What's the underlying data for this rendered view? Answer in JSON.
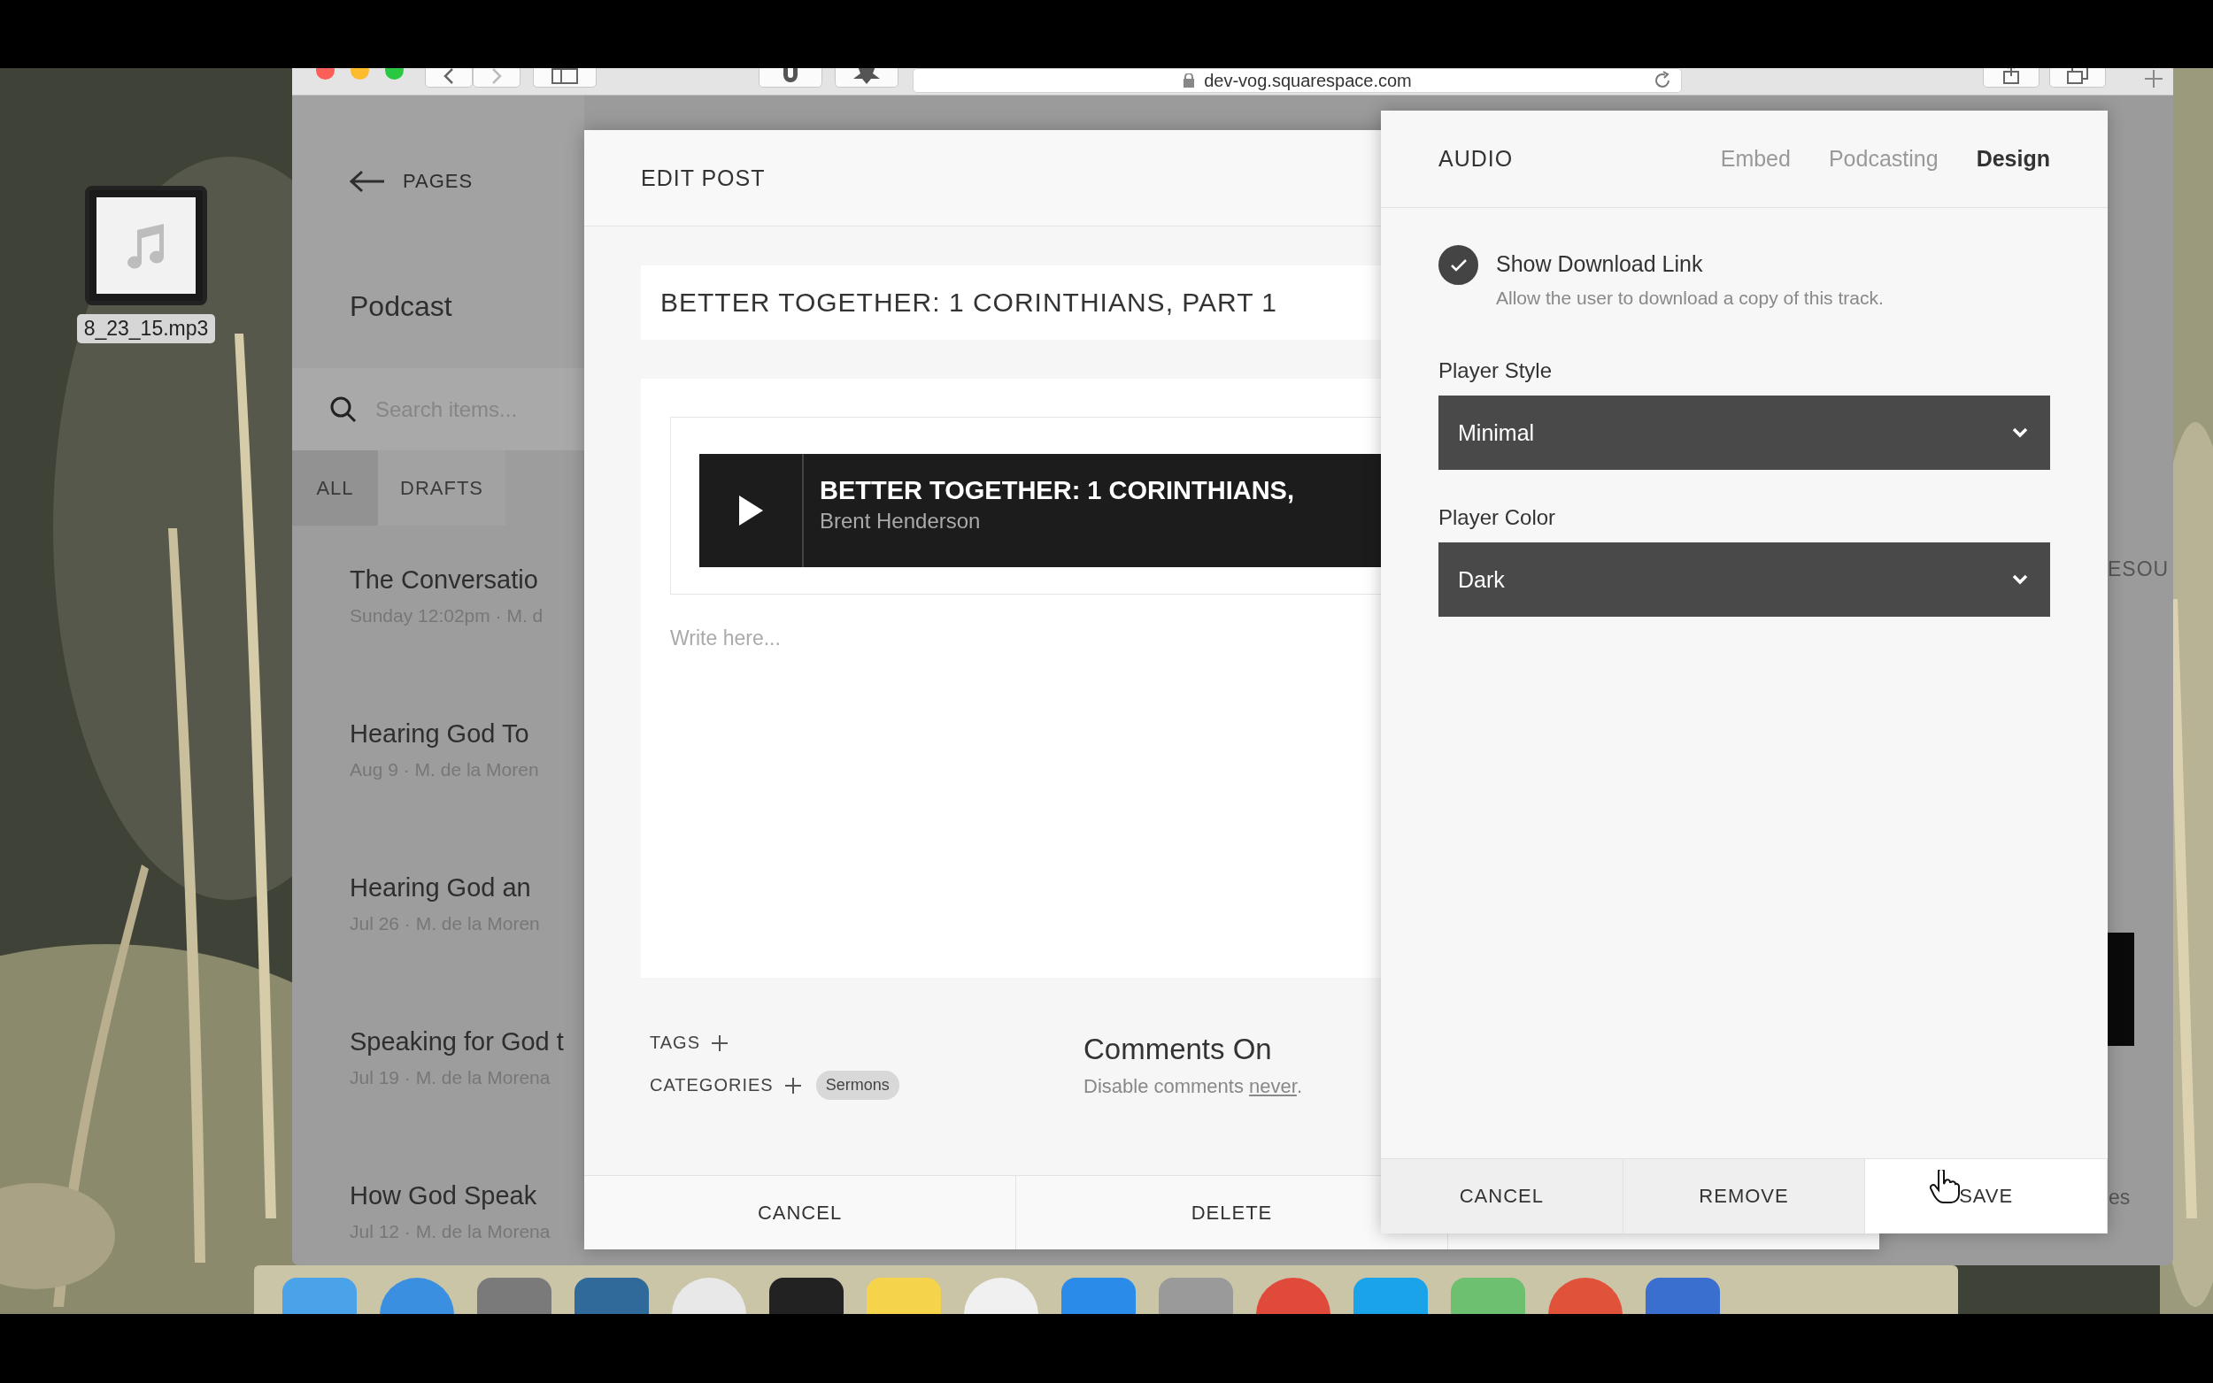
{
  "desktop": {
    "file_icon": {
      "label": "8_23_15.mp3"
    }
  },
  "browser": {
    "address": "dev-vog.squarespace.com"
  },
  "sidebar": {
    "back_label": "PAGES",
    "title": "Podcast",
    "search": {
      "placeholder": "Search items..."
    },
    "tabs": [
      {
        "label": "ALL",
        "selected": true
      },
      {
        "label": "DRAFTS",
        "selected": false
      }
    ],
    "items": [
      {
        "title": "The Conversatio",
        "meta": "Sunday 12:02pm  ·  M. d"
      },
      {
        "title": "Hearing God To",
        "meta": "Aug 9  ·  M. de la Moren"
      },
      {
        "title": "Hearing God an",
        "meta": "Jul 26  ·  M. de la Moren"
      },
      {
        "title": "Speaking for God t",
        "meta": "Jul 19  ·  M. de la Morena"
      },
      {
        "title": "How God Speak",
        "meta": "Jul 12  ·  M. de la Morena"
      }
    ]
  },
  "edit_post": {
    "title": "EDIT POST",
    "post_title": "BETTER TOGETHER: 1 CORINTHIANS, PART 1",
    "audio_block": {
      "title": "BETTER TOGETHER: 1 CORINTHIANS,",
      "artist": "Brent Henderson"
    },
    "body": {
      "placeholder": "Write here..."
    },
    "tags_label": "TAGS",
    "categories_label": "CATEGORIES",
    "categories": [
      "Sermons"
    ],
    "comments": {
      "title": "Comments On",
      "text": "Disable comments",
      "link": "never",
      "end": "."
    },
    "buttons": [
      "CANCEL",
      "DELETE"
    ]
  },
  "background_page": {
    "heading_fragment": "ESOU",
    "text_fragment": "es"
  },
  "audio_panel": {
    "title": "AUDIO",
    "tabs": [
      {
        "label": "Embed",
        "selected": false
      },
      {
        "label": "Podcasting",
        "selected": false
      },
      {
        "label": "Design",
        "selected": true
      }
    ],
    "show_download": {
      "label": "Show Download Link",
      "description": "Allow the user to download a copy of this track.",
      "checked": true
    },
    "fields": [
      {
        "label": "Player Style",
        "value": "Minimal"
      },
      {
        "label": "Player Color",
        "value": "Dark"
      }
    ],
    "buttons": [
      {
        "label": "CANCEL",
        "highlighted": false
      },
      {
        "label": "REMOVE",
        "highlighted": false
      },
      {
        "label": "SAVE",
        "highlighted": true
      }
    ]
  }
}
